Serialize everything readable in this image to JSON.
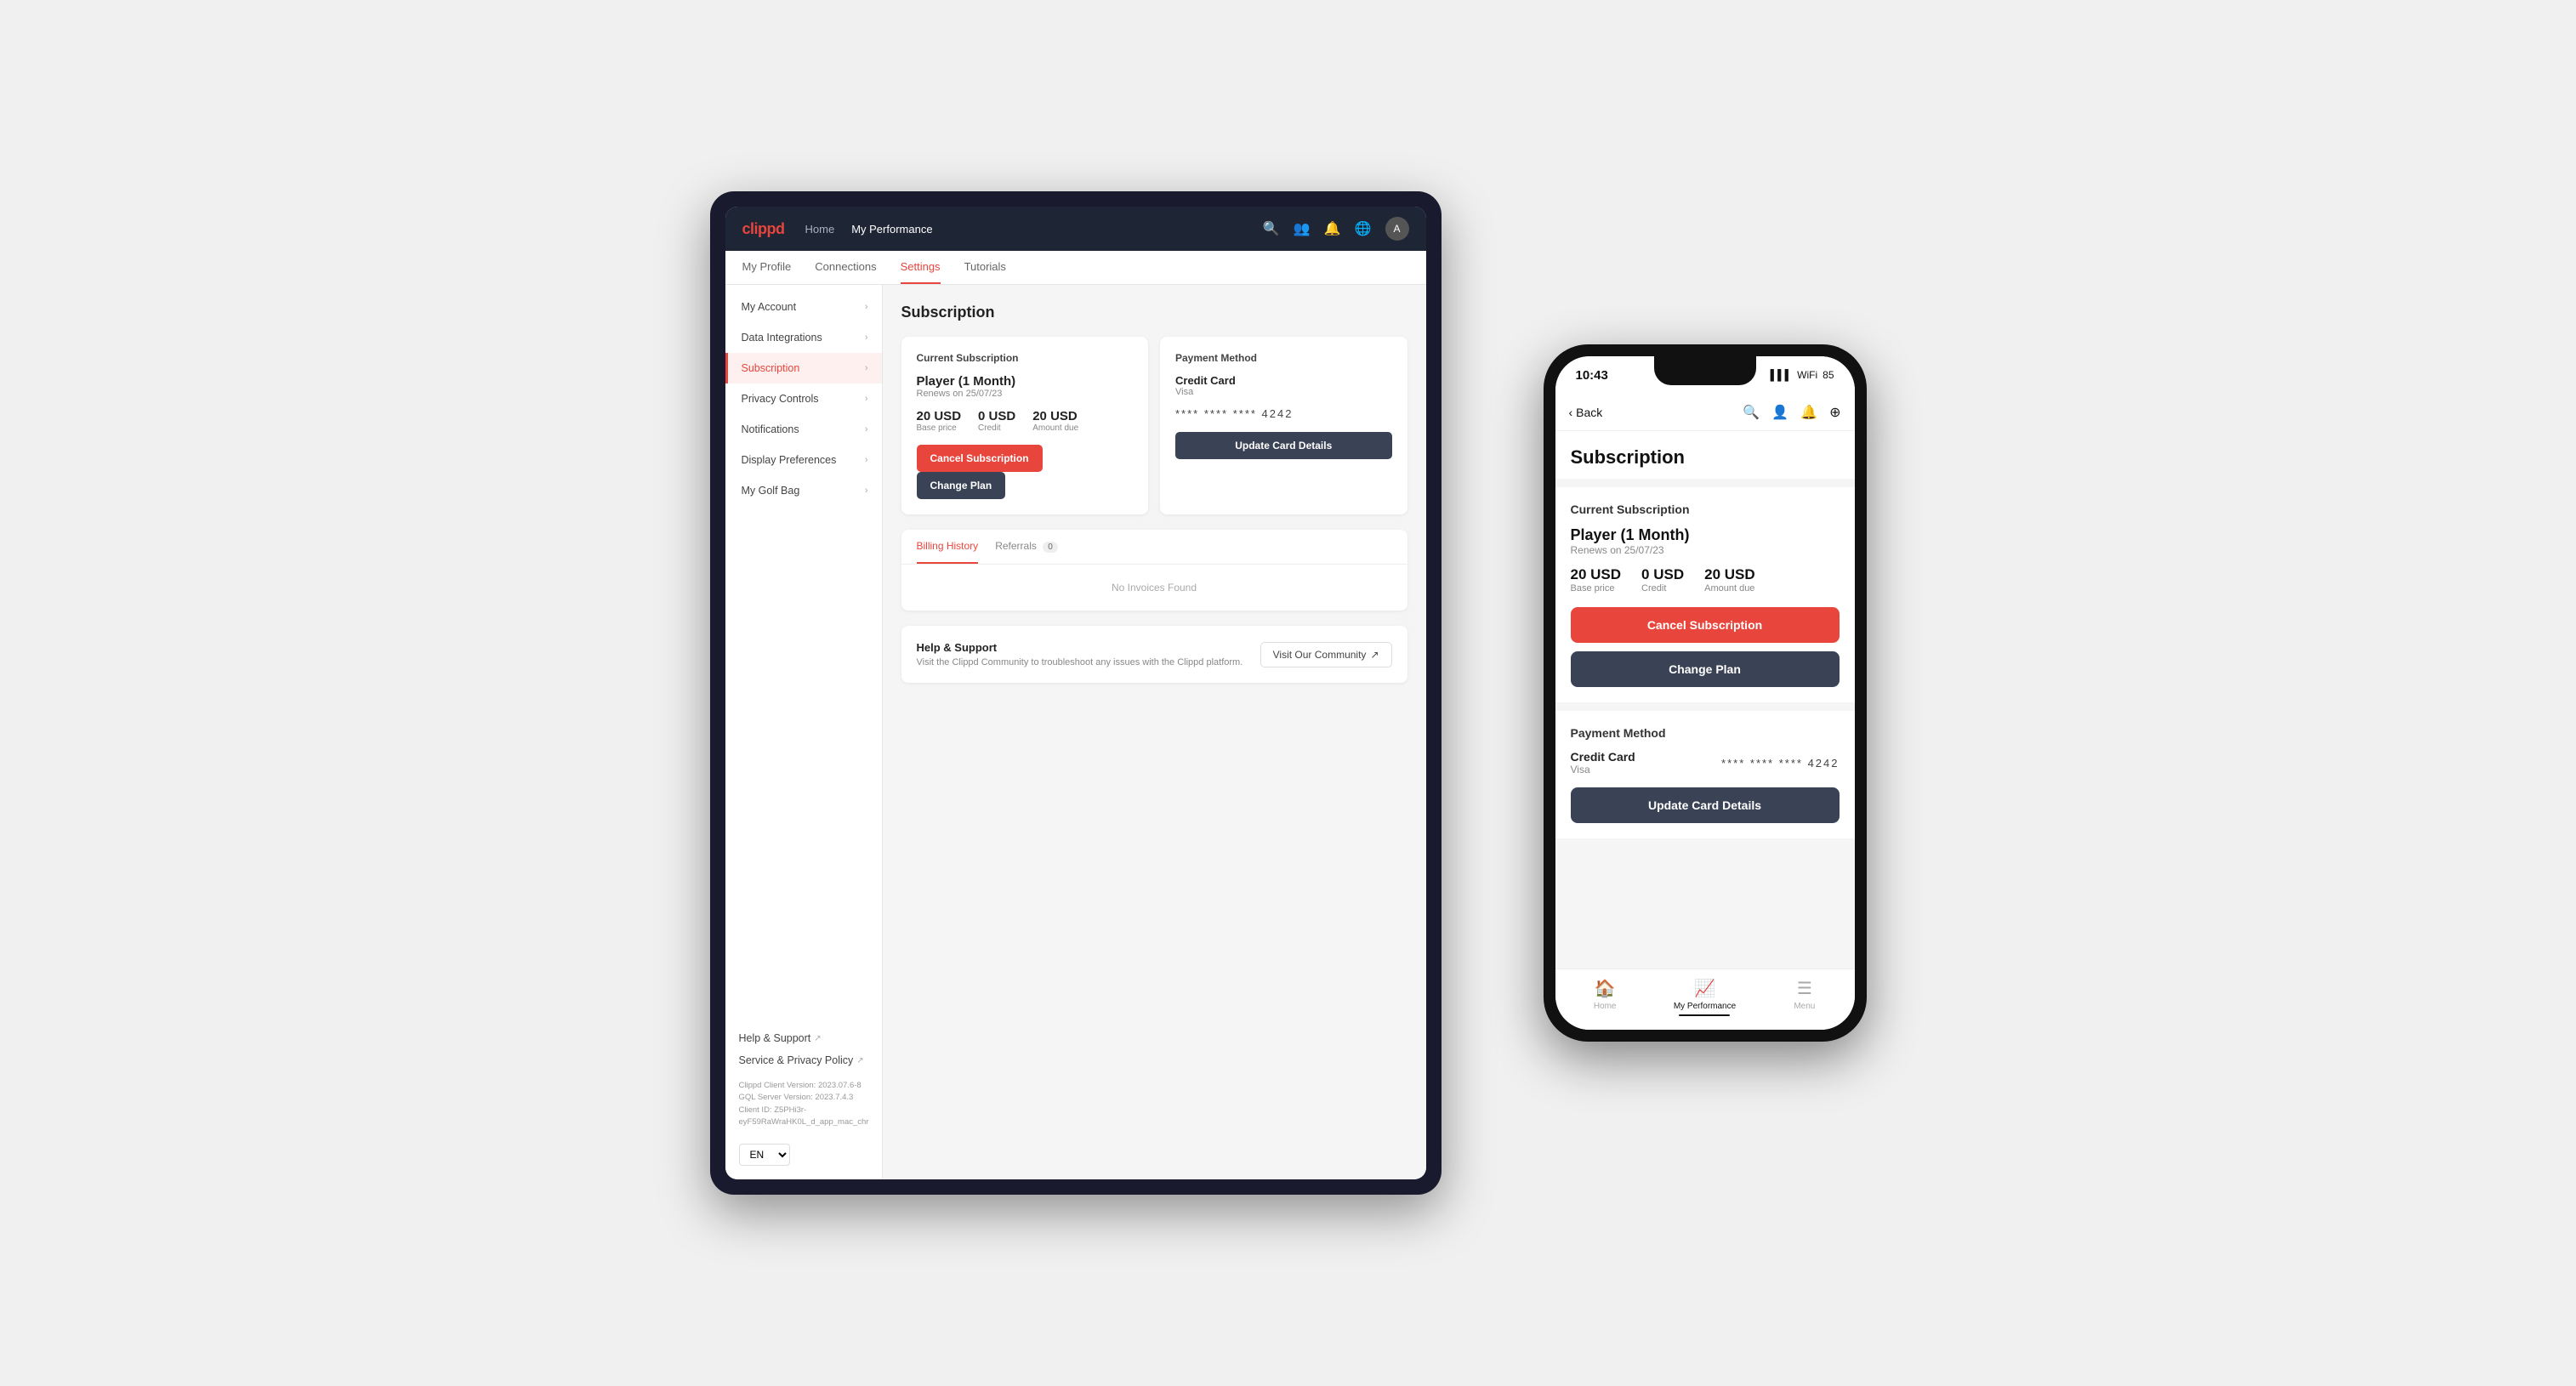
{
  "tablet": {
    "logo": "clippd",
    "nav": {
      "links": [
        "Home",
        "My Performance"
      ],
      "active": "My Performance",
      "icons": [
        "🔍",
        "👥",
        "🔔",
        "🌐",
        "A"
      ]
    },
    "tabs": [
      "My Profile",
      "Connections",
      "Settings",
      "Tutorials"
    ],
    "active_tab": "Settings",
    "sidebar": {
      "items": [
        {
          "label": "My Account",
          "active": false
        },
        {
          "label": "Data Integrations",
          "active": false
        },
        {
          "label": "Subscription",
          "active": true
        },
        {
          "label": "Privacy Controls",
          "active": false
        },
        {
          "label": "Notifications",
          "active": false
        },
        {
          "label": "Display Preferences",
          "active": false
        },
        {
          "label": "My Golf Bag",
          "active": false
        }
      ],
      "footer_links": [
        {
          "label": "Help & Support"
        },
        {
          "label": "Service & Privacy Policy"
        }
      ],
      "footer_meta": "Clippd Client Version: 2023.07.6-8\nGQL Server Version: 2023.7.4.3\nClient ID: Z5PHi3r-eyF59RaWraHK0L_d_app_mac_chr",
      "lang": "EN"
    },
    "main": {
      "page_title": "Subscription",
      "current_subscription": {
        "title": "Current Subscription",
        "plan_name": "Player (1 Month)",
        "renews": "Renews on 25/07/23",
        "base_price": "20 USD",
        "base_price_label": "Base price",
        "credit": "0 USD",
        "credit_label": "Credit",
        "amount_due": "20 USD",
        "amount_due_label": "Amount due",
        "cancel_btn": "Cancel Subscription",
        "change_btn": "Change Plan"
      },
      "payment_method": {
        "title": "Payment Method",
        "card_type": "Credit Card",
        "card_brand": "Visa",
        "card_number": "**** **** **** 4242",
        "update_btn": "Update Card Details"
      },
      "billing": {
        "tabs": [
          "Billing History",
          "Referrals"
        ],
        "active_tab": "Billing History",
        "referrals_count": "0",
        "no_invoices": "No Invoices Found"
      },
      "help": {
        "title": "Help & Support",
        "description": "Visit the Clippd Community to troubleshoot any issues with the Clippd platform.",
        "visit_btn": "Visit Our Community"
      }
    }
  },
  "phone": {
    "status_bar": {
      "time": "10:43",
      "signal": "▌▌▌",
      "wifi": "WiFi",
      "battery": "85"
    },
    "nav": {
      "back_label": "Back",
      "icons": [
        "🔍",
        "👤",
        "🔔",
        "+"
      ]
    },
    "page_title": "Subscription",
    "current_subscription": {
      "title": "Current Subscription",
      "plan_name": "Player (1 Month)",
      "renews": "Renews on 25/07/23",
      "base_price": "20 USD",
      "base_price_label": "Base price",
      "credit": "0 USD",
      "credit_label": "Credit",
      "amount_due": "20 USD",
      "amount_due_label": "Amount due",
      "cancel_btn": "Cancel Subscription",
      "change_btn": "Change Plan"
    },
    "payment_method": {
      "title": "Payment Method",
      "card_type": "Credit Card",
      "card_brand": "Visa",
      "card_number": "**** **** **** 4242",
      "update_btn": "Update Card Details"
    },
    "bottom_nav": [
      {
        "label": "Home",
        "active": false,
        "icon": "🏠"
      },
      {
        "label": "My Performance",
        "active": true,
        "icon": "📈"
      },
      {
        "label": "Menu",
        "active": false,
        "icon": "☰"
      }
    ]
  }
}
